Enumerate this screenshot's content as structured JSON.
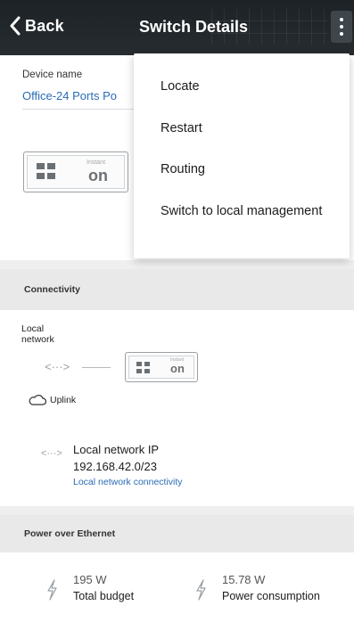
{
  "header": {
    "back_label": "Back",
    "title": "Switch Details"
  },
  "device": {
    "label": "Device name",
    "name_value": "Office-24 Ports Po",
    "instant_label": "Instant",
    "on_label": "on"
  },
  "menu": {
    "items": [
      {
        "label": "Locate"
      },
      {
        "label": "Restart"
      },
      {
        "label": "Routing"
      },
      {
        "label": "Switch to local management"
      }
    ]
  },
  "connectivity": {
    "section_title": "Connectivity",
    "local_network_label": "Local\nnetwork",
    "link_arrows": "<···>",
    "instant_label": "Instant",
    "on_label": "on",
    "uplink_label": "Uplink",
    "local_ip_icon": "<···>",
    "local_ip_label": "Local network IP",
    "local_ip_value": "192.168.42.0/23",
    "local_ip_link": "Local network connectivity"
  },
  "poe": {
    "section_title": "Power over Ethernet",
    "total_budget_value": "195 W",
    "total_budget_label": "Total budget",
    "consumption_value": "15.78 W",
    "consumption_label": "Power consumption"
  },
  "colors": {
    "header_bg": "#22282c",
    "link_blue": "#2a6bb5",
    "section_bg": "#e9e9e9"
  },
  "icons": [
    "back-chevron-icon",
    "more-vert-icon",
    "switch-device-icon",
    "link-arrows-icon",
    "cloud-icon",
    "power-plug-icon"
  ]
}
